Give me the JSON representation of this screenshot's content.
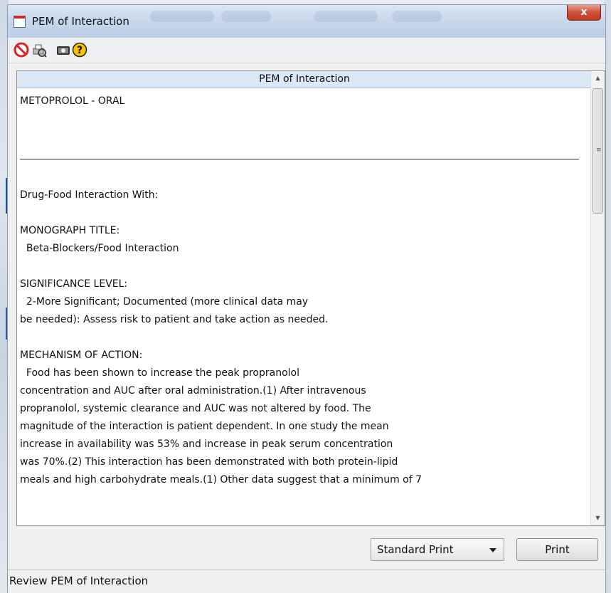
{
  "window": {
    "title": "PEM of Interaction",
    "close_label": "x"
  },
  "toolbar": {
    "icons": [
      "stop-icon",
      "print-preview-icon",
      "camera-icon",
      "help-icon"
    ]
  },
  "report": {
    "header": "PEM of Interaction",
    "drug": "METOPROLOL - ORAL",
    "interaction_label": "Drug-Food Interaction With:",
    "monograph_title_label": "MONOGRAPH TITLE:",
    "monograph_title": "  Beta-Blockers/Food Interaction",
    "significance_label": "SIGNIFICANCE LEVEL:",
    "significance_lines": [
      "  2-More Significant; Documented (more clinical data may",
      "be needed): Assess risk to patient and take action as needed."
    ],
    "mechanism_label": "MECHANISM OF ACTION:",
    "mechanism_lines": [
      "  Food has been shown to increase the peak propranolol",
      "concentration and AUC after oral administration.(1) After intravenous",
      "propranolol, systemic clearance and AUC was not altered by food. The",
      "magnitude of the interaction is patient dependent. In one study the mean",
      "increase in availability was 53% and increase in peak serum concentration",
      "was 70%.(2) This interaction has been demonstrated with both protein-lipid",
      "meals and high carbohydrate meals.(1) Other data suggest that a minimum of 7"
    ]
  },
  "controls": {
    "print_mode": "Standard Print",
    "print_button": "Print"
  },
  "status": {
    "text": "Review PEM of Interaction"
  },
  "colors": {
    "header_bg": "#dbe8f6",
    "close_red": "#c23a24"
  }
}
